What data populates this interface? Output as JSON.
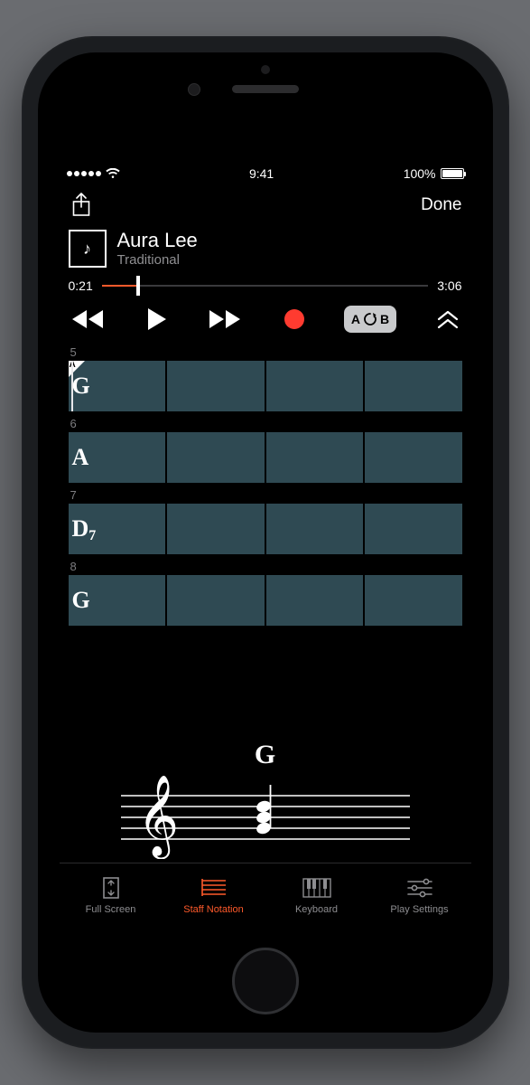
{
  "status": {
    "time": "9:41",
    "battery_pct": "100%"
  },
  "nav": {
    "done": "Done"
  },
  "song": {
    "title": "Aura Lee",
    "subtitle": "Traditional",
    "icon_glyph": "♪"
  },
  "progress": {
    "elapsed": "0:21",
    "total": "3:06",
    "pct": 11
  },
  "ab": {
    "a": "A",
    "b": "B"
  },
  "measures": [
    {
      "num": "5",
      "chord": "G",
      "sub": "",
      "marker": "A",
      "playhead": true
    },
    {
      "num": "6",
      "chord": "A",
      "sub": "",
      "marker": "",
      "playhead": false
    },
    {
      "num": "7",
      "chord": "D",
      "sub": "7",
      "marker": "",
      "playhead": false
    },
    {
      "num": "8",
      "chord": "G",
      "sub": "",
      "marker": "",
      "playhead": false
    }
  ],
  "current_chord": "G",
  "tabs": {
    "full_screen": "Full Screen",
    "staff": "Staff Notation",
    "keyboard": "Keyboard",
    "play_settings": "Play Settings"
  }
}
